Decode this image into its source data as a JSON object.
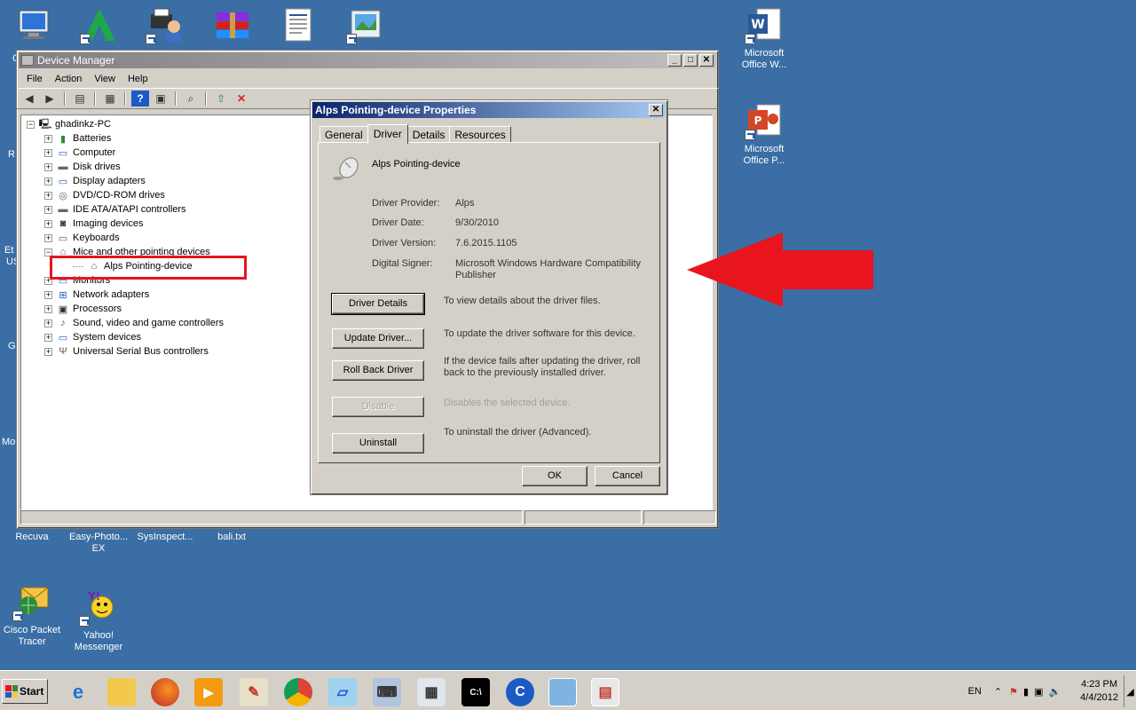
{
  "desktop": {
    "icons": [
      {
        "label": "Recuva"
      },
      {
        "label": "Easy-Photo... EX"
      },
      {
        "label": "SysInspect..."
      },
      {
        "label": "bali.txt"
      },
      {
        "label": "Cisco Packet Tracer"
      },
      {
        "label": "Yahoo! Messenger"
      },
      {
        "label": "Microsoft Office W..."
      },
      {
        "label": "Microsoft Office P..."
      }
    ],
    "edge_labels": [
      "C",
      "R",
      "Et",
      "US",
      "G",
      "Mo"
    ]
  },
  "device_manager": {
    "title": "Device Manager",
    "menu": [
      "File",
      "Action",
      "View",
      "Help"
    ],
    "tree": {
      "root": "ghadinkz-PC",
      "items": [
        {
          "label": "Batteries",
          "sign": "+"
        },
        {
          "label": "Computer",
          "sign": "+"
        },
        {
          "label": "Disk drives",
          "sign": "+"
        },
        {
          "label": "Display adapters",
          "sign": "+"
        },
        {
          "label": "DVD/CD-ROM drives",
          "sign": "+"
        },
        {
          "label": "IDE ATA/ATAPI controllers",
          "sign": "+"
        },
        {
          "label": "Imaging devices",
          "sign": "+"
        },
        {
          "label": "Keyboards",
          "sign": "+"
        },
        {
          "label": "Mice and other pointing devices",
          "sign": "−"
        },
        {
          "label": "Alps Pointing-device",
          "sign": ""
        },
        {
          "label": "Monitors",
          "sign": "+"
        },
        {
          "label": "Network adapters",
          "sign": "+"
        },
        {
          "label": "Processors",
          "sign": "+"
        },
        {
          "label": "Sound, video and game controllers",
          "sign": "+"
        },
        {
          "label": "System devices",
          "sign": "+"
        },
        {
          "label": "Universal Serial Bus controllers",
          "sign": "+"
        }
      ]
    }
  },
  "properties": {
    "title": "Alps Pointing-device Properties",
    "tabs": [
      "General",
      "Driver",
      "Details",
      "Resources"
    ],
    "device_name": "Alps Pointing-device",
    "fields": [
      {
        "label": "Driver Provider:",
        "value": "Alps"
      },
      {
        "label": "Driver Date:",
        "value": "9/30/2010"
      },
      {
        "label": "Driver Version:",
        "value": "7.6.2015.1105"
      },
      {
        "label": "Digital Signer:",
        "value": "Microsoft Windows Hardware Compatibility Publisher"
      }
    ],
    "actions": [
      {
        "button": "Driver Details",
        "desc": "To view details about the driver files."
      },
      {
        "button": "Update Driver...",
        "desc": "To update the driver software for this device."
      },
      {
        "button": "Roll Back Driver",
        "desc": "If the device fails after updating the driver, roll back to the previously installed driver."
      },
      {
        "button": "Disable",
        "desc": "Disables the selected device."
      },
      {
        "button": "Uninstall",
        "desc": "To uninstall the driver (Advanced)."
      }
    ],
    "ok": "OK",
    "cancel": "Cancel"
  },
  "taskbar": {
    "start": "Start",
    "language": "EN",
    "time": "4:23 PM",
    "date": "4/4/2012"
  },
  "colors": {
    "desktop": "#3a6ea5",
    "highlight_box": "#e8141e",
    "arrow": "#e8141e"
  }
}
